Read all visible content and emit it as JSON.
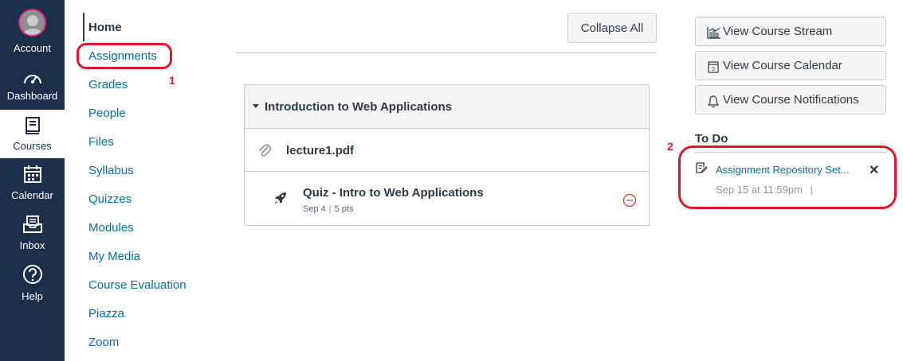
{
  "global_nav": {
    "items": [
      {
        "label": "Account",
        "icon": "account-avatar"
      },
      {
        "label": "Dashboard",
        "icon": "dashboard-gauge-icon"
      },
      {
        "label": "Courses",
        "icon": "courses-book-icon"
      },
      {
        "label": "Calendar",
        "icon": "calendar-icon"
      },
      {
        "label": "Inbox",
        "icon": "inbox-icon"
      },
      {
        "label": "Help",
        "icon": "help-icon"
      }
    ],
    "active": "Courses",
    "colors": {
      "background": "#1b2f4a",
      "avatar_ring": "#e0257f"
    }
  },
  "course_nav": {
    "items": [
      "Home",
      "Assignments",
      "Grades",
      "People",
      "Files",
      "Syllabus",
      "Quizzes",
      "Modules",
      "My Media",
      "Course Evaluation",
      "Piazza",
      "Zoom"
    ],
    "active": "Home",
    "link_color": "#0770a3"
  },
  "annotations": {
    "marker_1": "1",
    "marker_2": "2",
    "color": "#e0162b"
  },
  "main": {
    "collapse_all_label": "Collapse All",
    "module": {
      "title": "Introduction to Web Applications",
      "items": [
        {
          "name": "lecture1.pdf",
          "icon": "paperclip-icon"
        },
        {
          "name": "Quiz - Intro to Web Applications",
          "date": "Sep 4",
          "points": "5 pts",
          "icon": "rocket-icon",
          "status_icon": "minus-circle-icon"
        }
      ]
    }
  },
  "sidebar": {
    "buttons": [
      {
        "label": "View Course Stream",
        "icon": "stream-chart-icon"
      },
      {
        "label": "View Course Calendar",
        "icon": "calendar-icon"
      },
      {
        "label": "View Course Notifications",
        "icon": "bell-icon"
      }
    ],
    "todo": {
      "title": "To Do",
      "items": [
        {
          "title": "Assignment Repository Set...",
          "due": "Sep 15 at 11:59pm",
          "separator": "|",
          "close": "✕"
        }
      ]
    }
  }
}
